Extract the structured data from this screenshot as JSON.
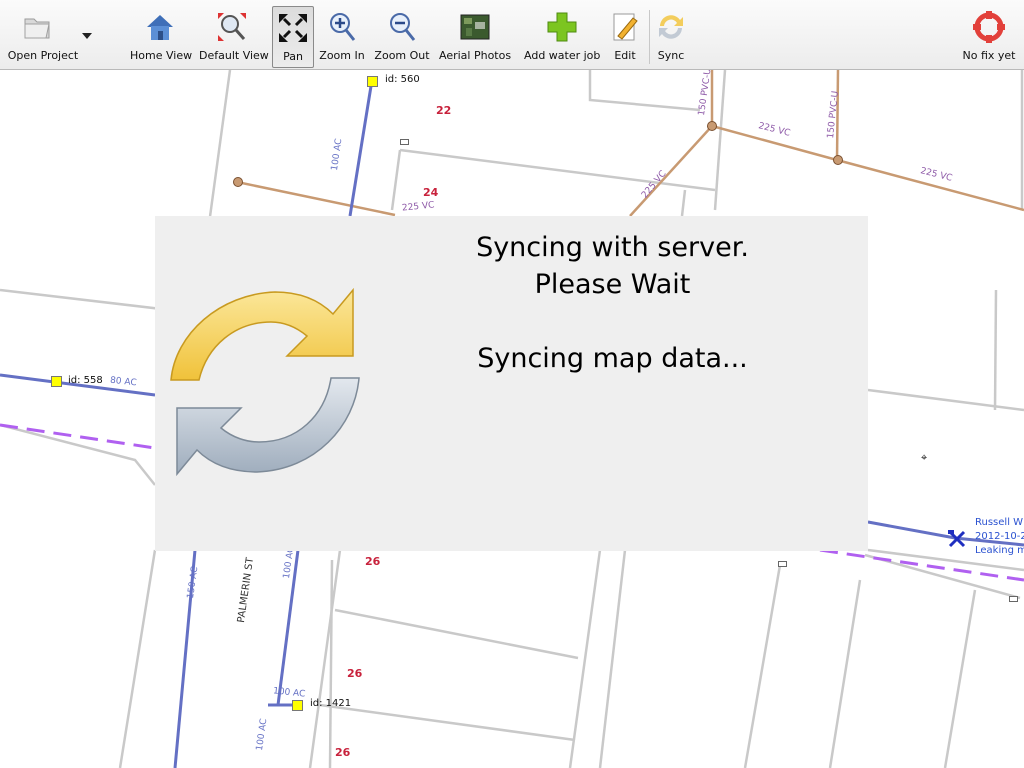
{
  "toolbar": {
    "open_project": "Open Project",
    "home_view": "Home View",
    "default_view": "Default View",
    "pan": "Pan",
    "zoom_in": "Zoom In",
    "zoom_out": "Zoom Out",
    "aerial_photos": "Aerial Photos",
    "add_water_job": "Add water job",
    "edit": "Edit",
    "sync": "Sync",
    "gps_status": "No fix yet",
    "active_tool": "Pan"
  },
  "map": {
    "node_labels": [
      "id: 560",
      "id: 558",
      "id: 1421"
    ],
    "lot_numbers": [
      "22",
      "24",
      "26",
      "26",
      "26"
    ],
    "pipe_labels": [
      "100 AC",
      "225 VC",
      "225 VC",
      "150 PVC-U",
      "225 VC",
      "150 PVC-U",
      "225 VC",
      "80 AC",
      "150 AC",
      "100 AC",
      "100 AC",
      "100 AC"
    ],
    "street_name": "PALMERIN ST",
    "job_marker": {
      "lines": [
        "Russell W",
        "2012-10-2",
        "Leaking m"
      ]
    }
  },
  "sync_dialog": {
    "line1": "Syncing with server.",
    "line2": "Please Wait",
    "status": "Syncing map data..."
  },
  "colors": {
    "water_main": "#6470c4",
    "sewer": "#c89a72",
    "boundary": "#c9c9c9",
    "dashed": "#b060f0",
    "lot_number": "#c8223c",
    "dialog_bg": "#efefef"
  }
}
